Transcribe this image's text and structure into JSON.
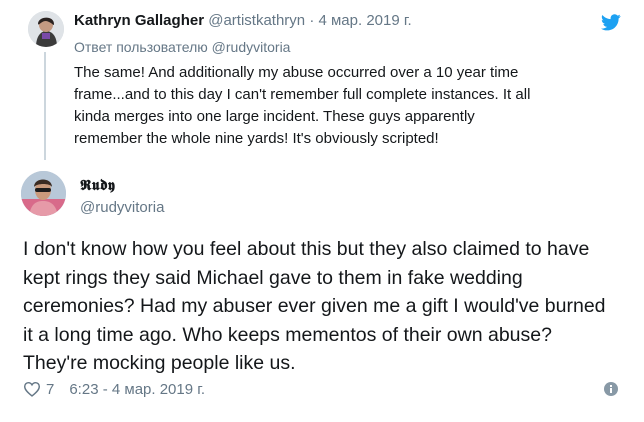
{
  "quoted_tweet": {
    "display_name": "Kathryn Gallagher",
    "handle": "@artistkathryn",
    "separator": "·",
    "date": "4 мар. 2019 г.",
    "reply_prefix": "Ответ пользователю",
    "reply_to": "@rudyvitoria",
    "text": "The same! And additionally my abuse occurred over a 10 year time\nframe...and to this day I can't remember full complete instances. It all\nkinda merges into one large incident. These guys apparently\nremember the whole nine yards! It's obviously scripted!"
  },
  "main_tweet": {
    "display_name": "𝕽𝖚𝖉𝖞",
    "handle": "@rudyvitoria",
    "text": "I don't know how you feel about this but they also claimed to have\nkept rings they said Michael gave to them in fake wedding\nceremonies? Had my abuser ever given me a gift I would've burned\nit a long time ago. Who keeps mementos of their own abuse?\nThey're mocking people like us.",
    "like_count": "7",
    "timestamp": "6:23 - 4 мар. 2019 г."
  },
  "icons": {
    "brand": "twitter-bird-icon",
    "like": "heart-outline-icon",
    "info": "info-icon"
  },
  "colors": {
    "brand_blue": "#1da1f2",
    "text": "#14171a",
    "muted": "#657786",
    "thread_line": "#ccd6dd"
  }
}
